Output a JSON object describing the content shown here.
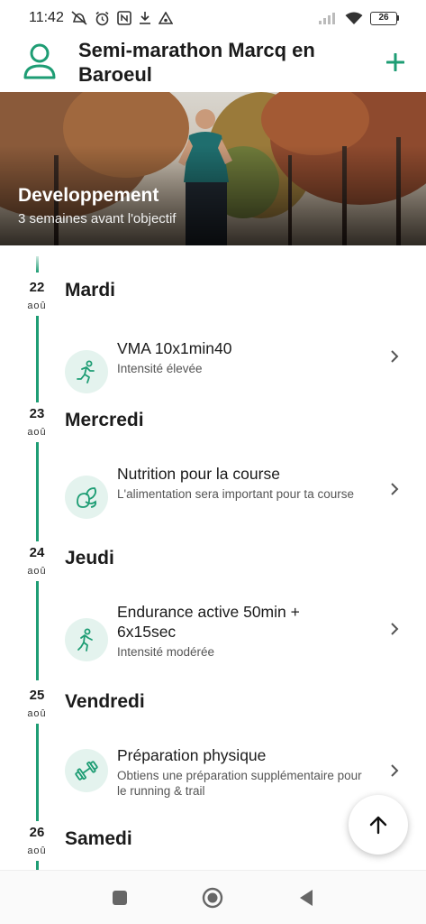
{
  "status_bar": {
    "time": "11:42",
    "battery": "26"
  },
  "header": {
    "title": "Semi-marathon Marcq en Baroeul"
  },
  "banner": {
    "phase": "Developpement",
    "subtitle": "3 semaines avant l'objectif"
  },
  "days": [
    {
      "day_num": "22",
      "month": "aoû",
      "day_name": "Mardi",
      "session": {
        "title": "VMA 10x1min40",
        "description": "Intensité élevée",
        "icon": "running-icon"
      }
    },
    {
      "day_num": "23",
      "month": "aoû",
      "day_name": "Mercredi",
      "session": {
        "title": "Nutrition pour la course",
        "description": "L'alimentation sera important pour ta course",
        "icon": "nutrition-icon"
      }
    },
    {
      "day_num": "24",
      "month": "aoû",
      "day_name": "Jeudi",
      "session": {
        "title": "Endurance active 50min + 6x15sec",
        "description": "Intensité modérée",
        "icon": "running-icon"
      }
    },
    {
      "day_num": "25",
      "month": "aoû",
      "day_name": "Vendredi",
      "session": {
        "title": "Préparation physique",
        "description": "Obtiens une préparation supplémentaire pour le running & trail",
        "icon": "dumbbell-icon"
      }
    },
    {
      "day_num": "26",
      "month": "aoû",
      "day_name": "Samedi"
    }
  ],
  "colors": {
    "accent": "#1e9d74",
    "icon_bg": "#e4f3ee"
  }
}
